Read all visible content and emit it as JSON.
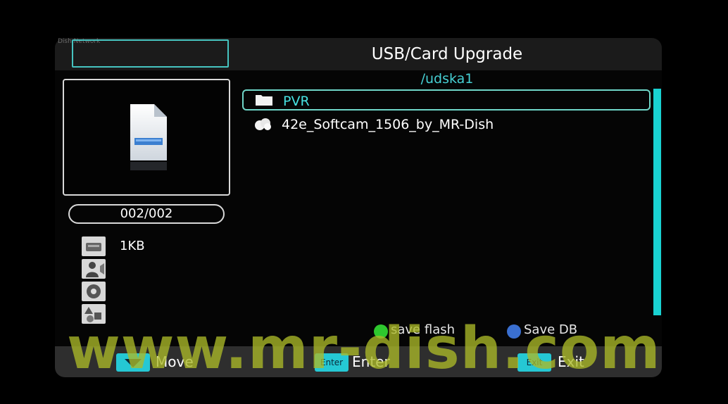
{
  "header": {
    "title": "USB/Card Upgrade",
    "small_label": "Dish Network"
  },
  "path": "/udska1",
  "preview": {
    "icon": "file-icon"
  },
  "counter": "002/002",
  "info": {
    "size": "1KB",
    "icons": [
      "drive-icon",
      "user-icon",
      "disc-icon",
      "shapes-icon"
    ]
  },
  "files": [
    {
      "name": "PVR",
      "icon": "folder-icon",
      "selected": true
    },
    {
      "name": "42e_Softcam_1506_by_MR-Dish",
      "icon": "file-cloud-icon",
      "selected": false
    }
  ],
  "hints": {
    "save_flash": "save flash",
    "save_db": "Save DB",
    "green": "#2ec82e",
    "blue": "#3a6fd0"
  },
  "footer": {
    "move_label": "Move",
    "enter_key": "Enter",
    "enter_label": "Enter",
    "exit_key": "Exit",
    "exit_label": "Exit"
  },
  "watermark": "www.mr-dish.com",
  "colors": {
    "accent": "#46d0d4",
    "scrollbar": "#19d2d2",
    "key": "#25c8d4"
  }
}
